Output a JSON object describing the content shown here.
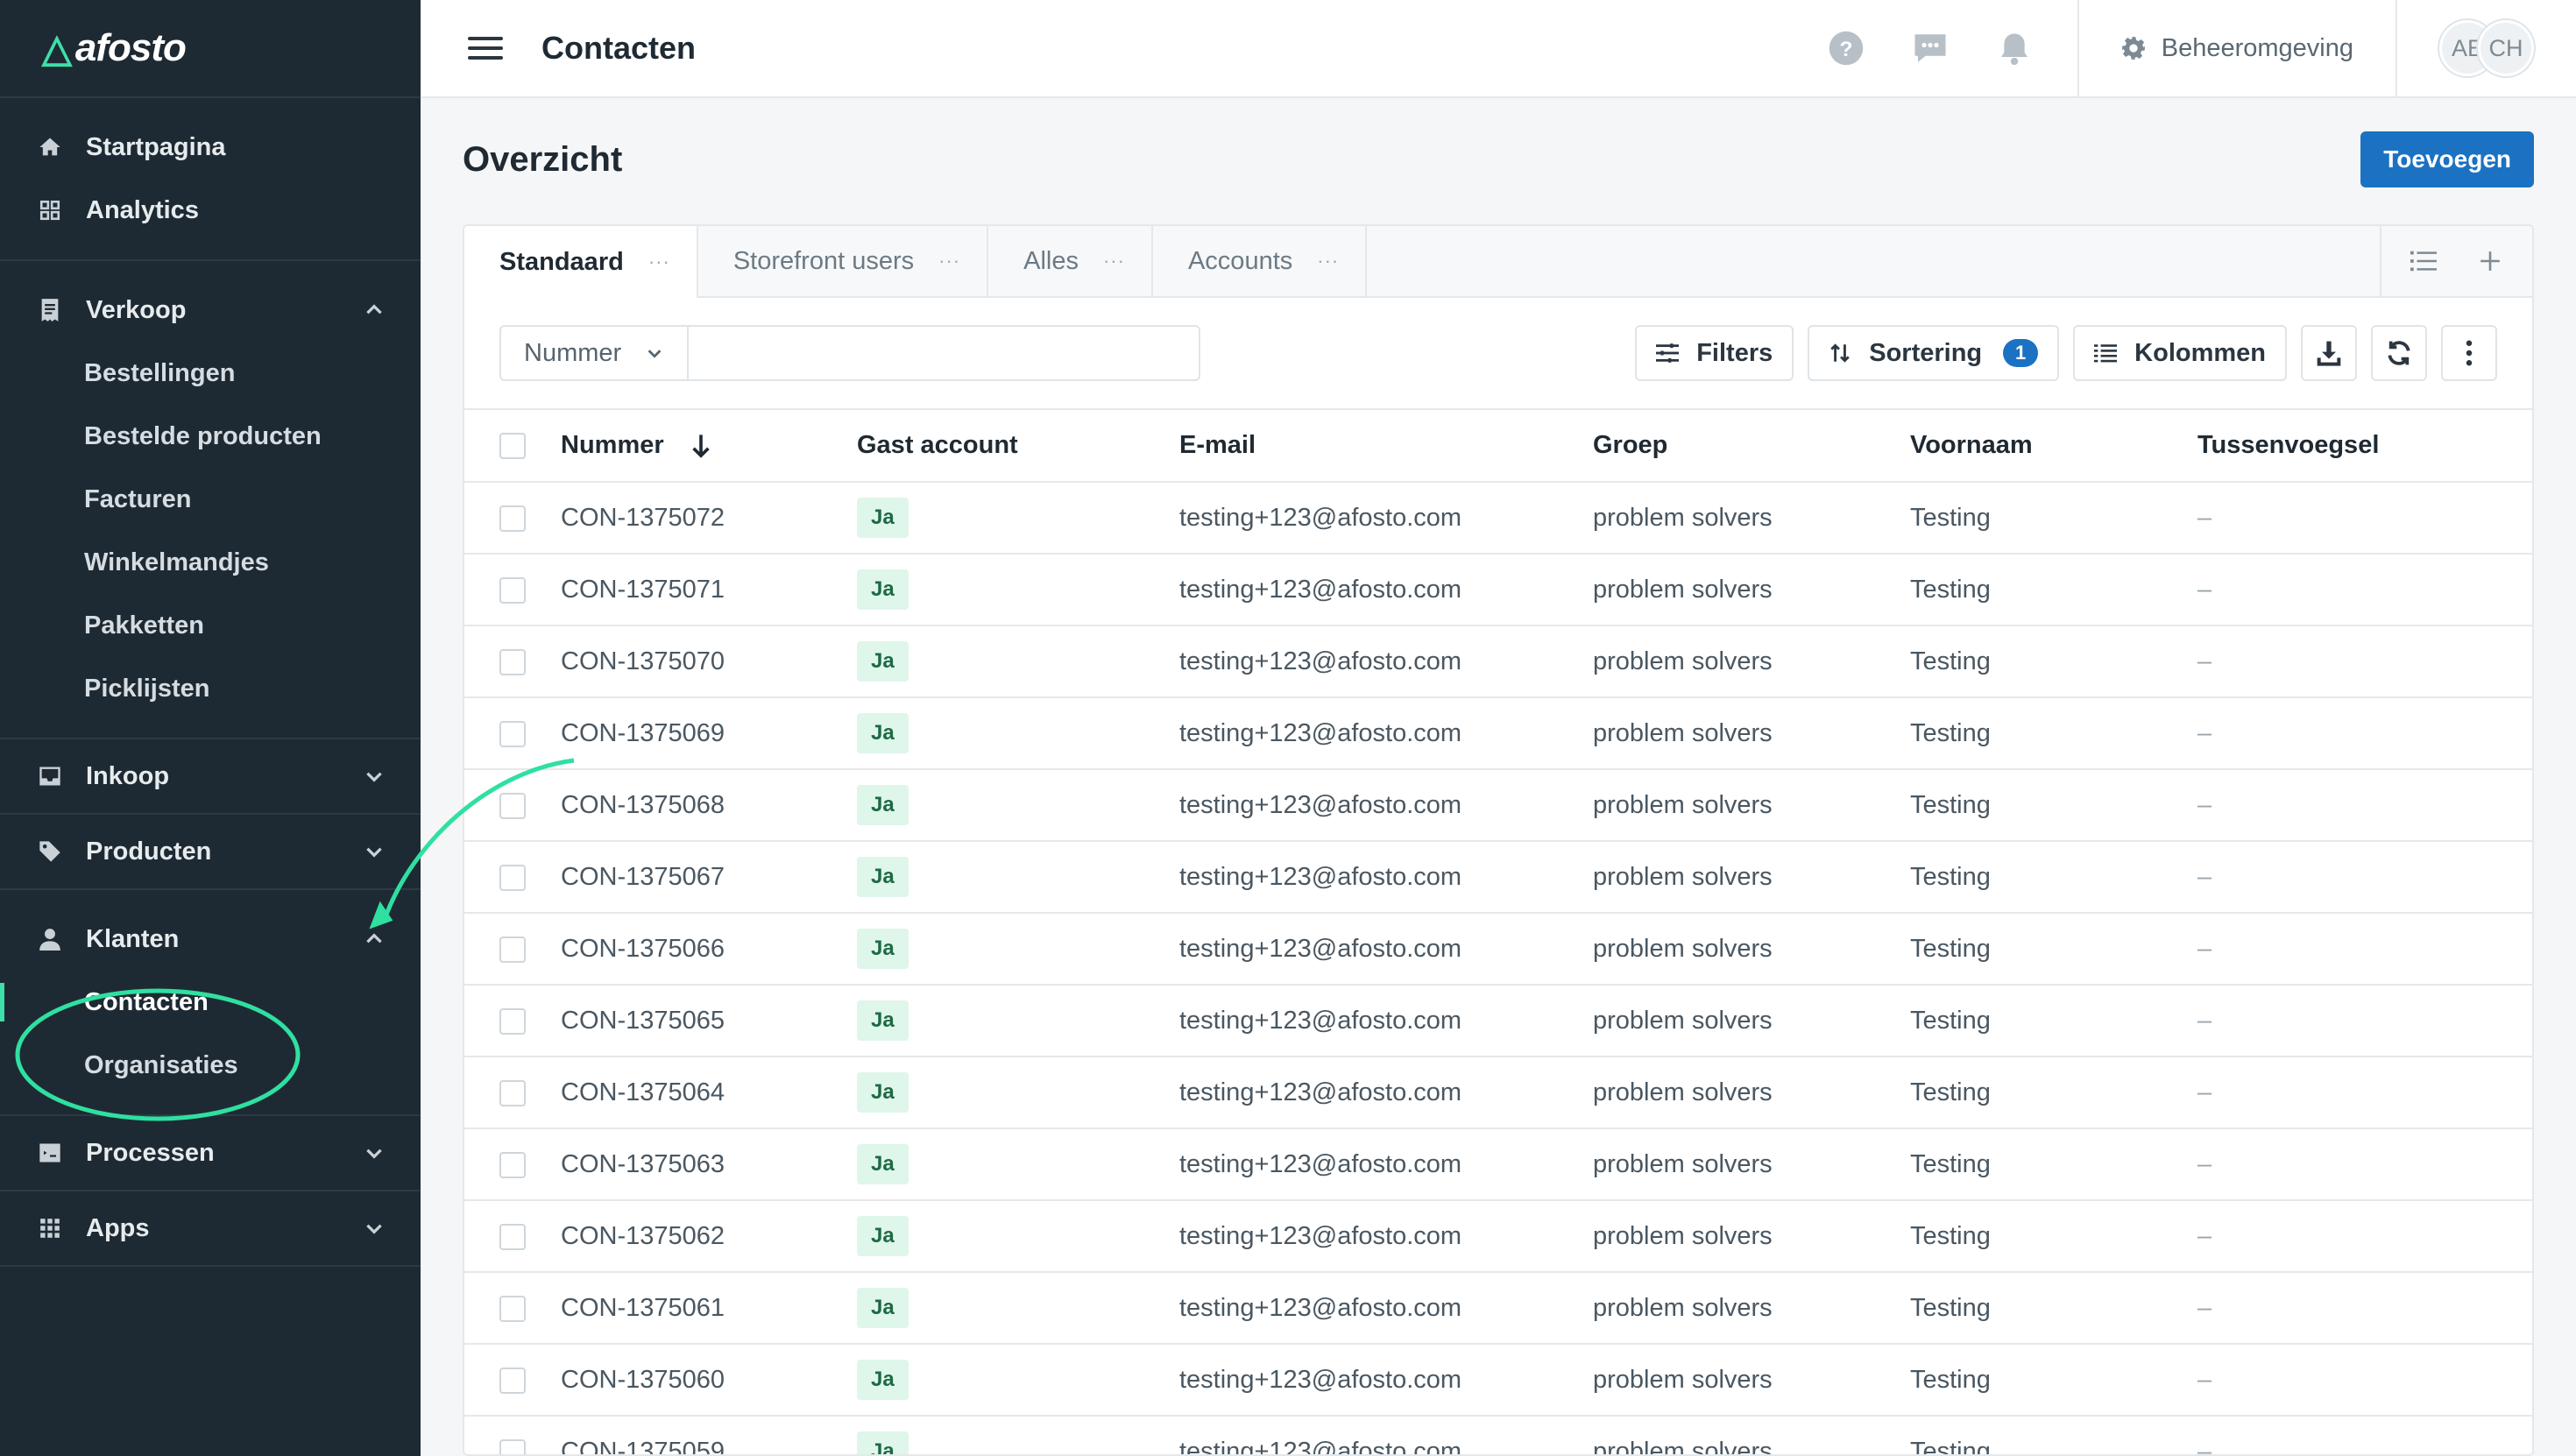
{
  "logo": {
    "mark": "△",
    "word": "afosto"
  },
  "sidebar": {
    "top_items": [
      {
        "label": "Startpagina",
        "icon": "home-icon"
      },
      {
        "label": "Analytics",
        "icon": "analytics-icon"
      }
    ],
    "verkoop": {
      "label": "Verkoop",
      "items": [
        "Bestellingen",
        "Bestelde producten",
        "Facturen",
        "Winkelmandjes",
        "Pakketten",
        "Picklijsten"
      ]
    },
    "inkoop": {
      "label": "Inkoop"
    },
    "producten": {
      "label": "Producten"
    },
    "klanten": {
      "label": "Klanten",
      "items": [
        "Contacten",
        "Organisaties"
      ]
    },
    "processen": {
      "label": "Processen"
    },
    "apps": {
      "label": "Apps"
    }
  },
  "topbar": {
    "title": "Contacten",
    "environment": "Beheeromgeving",
    "avatars": [
      "AE",
      "CH"
    ]
  },
  "page": {
    "title": "Overzicht",
    "add_button": "Toevoegen"
  },
  "tabs": [
    {
      "label": "Standaard",
      "dots": "···"
    },
    {
      "label": "Storefront users",
      "dots": "···"
    },
    {
      "label": "Alles",
      "dots": "···"
    },
    {
      "label": "Accounts",
      "dots": "···"
    }
  ],
  "toolbar": {
    "field_select": "Nummer",
    "search_value": "",
    "filters": "Filters",
    "sorting": "Sortering",
    "sorting_count": "1",
    "columns": "Kolommen"
  },
  "table": {
    "headers": {
      "number": "Nummer",
      "guest": "Gast account",
      "email": "E-mail",
      "group": "Groep",
      "first_name": "Voornaam",
      "infix": "Tussenvoegsel"
    },
    "rows": [
      {
        "number": "CON-1375072",
        "guest": "Ja",
        "email": "testing+123@afosto.com",
        "group": "problem solvers",
        "first_name": "Testing",
        "infix": "–"
      },
      {
        "number": "CON-1375071",
        "guest": "Ja",
        "email": "testing+123@afosto.com",
        "group": "problem solvers",
        "first_name": "Testing",
        "infix": "–"
      },
      {
        "number": "CON-1375070",
        "guest": "Ja",
        "email": "testing+123@afosto.com",
        "group": "problem solvers",
        "first_name": "Testing",
        "infix": "–"
      },
      {
        "number": "CON-1375069",
        "guest": "Ja",
        "email": "testing+123@afosto.com",
        "group": "problem solvers",
        "first_name": "Testing",
        "infix": "–"
      },
      {
        "number": "CON-1375068",
        "guest": "Ja",
        "email": "testing+123@afosto.com",
        "group": "problem solvers",
        "first_name": "Testing",
        "infix": "–"
      },
      {
        "number": "CON-1375067",
        "guest": "Ja",
        "email": "testing+123@afosto.com",
        "group": "problem solvers",
        "first_name": "Testing",
        "infix": "–"
      },
      {
        "number": "CON-1375066",
        "guest": "Ja",
        "email": "testing+123@afosto.com",
        "group": "problem solvers",
        "first_name": "Testing",
        "infix": "–"
      },
      {
        "number": "CON-1375065",
        "guest": "Ja",
        "email": "testing+123@afosto.com",
        "group": "problem solvers",
        "first_name": "Testing",
        "infix": "–"
      },
      {
        "number": "CON-1375064",
        "guest": "Ja",
        "email": "testing+123@afosto.com",
        "group": "problem solvers",
        "first_name": "Testing",
        "infix": "–"
      },
      {
        "number": "CON-1375063",
        "guest": "Ja",
        "email": "testing+123@afosto.com",
        "group": "problem solvers",
        "first_name": "Testing",
        "infix": "–"
      },
      {
        "number": "CON-1375062",
        "guest": "Ja",
        "email": "testing+123@afosto.com",
        "group": "problem solvers",
        "first_name": "Testing",
        "infix": "–"
      },
      {
        "number": "CON-1375061",
        "guest": "Ja",
        "email": "testing+123@afosto.com",
        "group": "problem solvers",
        "first_name": "Testing",
        "infix": "–"
      },
      {
        "number": "CON-1375060",
        "guest": "Ja",
        "email": "testing+123@afosto.com",
        "group": "problem solvers",
        "first_name": "Testing",
        "infix": "–"
      },
      {
        "number": "CON-1375059",
        "guest": "Ja",
        "email": "testing+123@afosto.com",
        "group": "problem solvers",
        "first_name": "Testing",
        "infix": "–"
      }
    ]
  },
  "colors": {
    "sidebar_bg": "#1e2a33",
    "accent_green": "#3de0a8",
    "primary_blue": "#1b72c2",
    "badge_bg": "#dff6ea",
    "annotation": "#2fe0a0"
  },
  "annotation": {
    "type": "arrow-and-ellipse",
    "target": "Contacten / Organisaties"
  }
}
